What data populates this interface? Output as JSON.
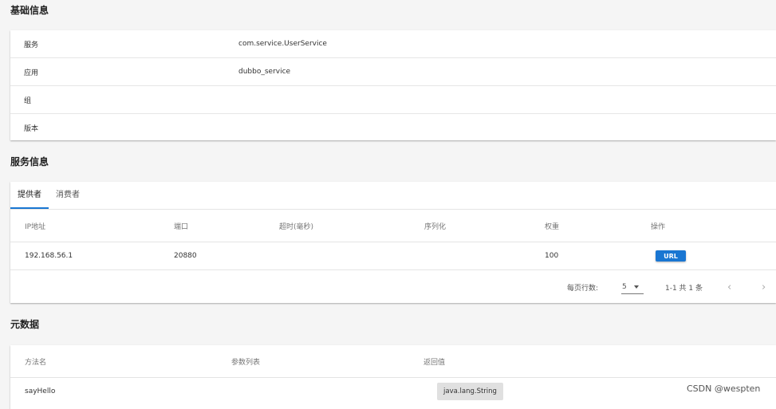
{
  "basic_info": {
    "title": "基础信息",
    "rows": [
      {
        "label": "服务",
        "value": "com.service.UserService"
      },
      {
        "label": "应用",
        "value": "dubbo_service"
      },
      {
        "label": "组",
        "value": ""
      },
      {
        "label": "版本",
        "value": ""
      }
    ]
  },
  "service_info": {
    "title": "服务信息",
    "tabs": [
      {
        "label": "提供者",
        "active": true
      },
      {
        "label": "消费者",
        "active": false
      }
    ],
    "columns": [
      "IP地址",
      "端口",
      "超时(毫秒)",
      "序列化",
      "权重",
      "操作"
    ],
    "rows": [
      {
        "ip": "192.168.56.1",
        "port": "20880",
        "timeout": "",
        "serialization": "",
        "weight": "100",
        "action": "URL"
      }
    ],
    "pagination": {
      "rows_per_page_label": "每页行数:",
      "rows_per_page": "5",
      "range_text": "1-1 共 1 条"
    }
  },
  "metadata": {
    "title": "元数据",
    "columns": [
      "方法名",
      "参数列表",
      "返回值"
    ],
    "rows": [
      {
        "method": "sayHello",
        "params": "",
        "return_type": "java.lang.String"
      }
    ]
  },
  "watermark": "CSDN @wespten",
  "colors": {
    "accent": "#1976d2",
    "background": "#f5f5f5",
    "chip": "#e0e0e0"
  },
  "icons": {
    "dropdown": "caret-down-icon",
    "prev": "chevron-left-icon",
    "next": "chevron-right-icon"
  }
}
